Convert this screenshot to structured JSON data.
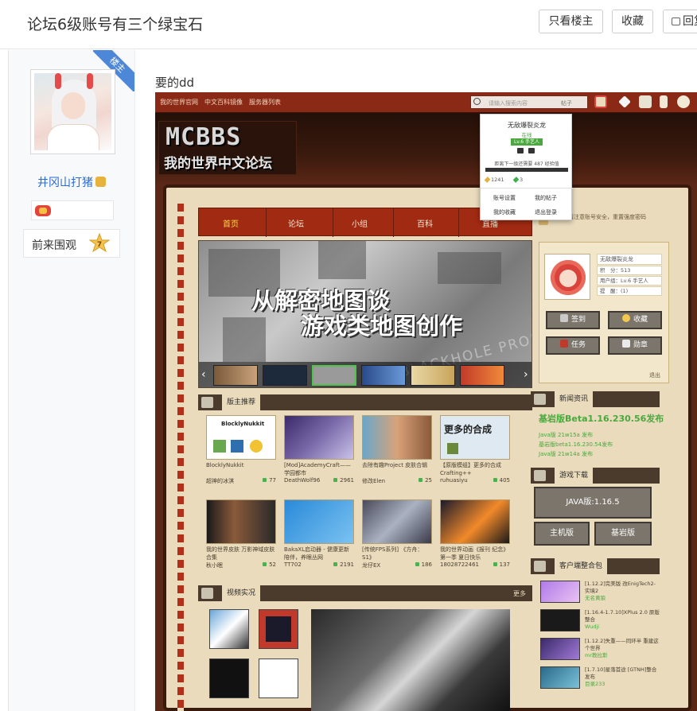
{
  "topbar": {
    "title": "论坛6级账号有三个绿宝石",
    "only_author_label": "只看楼主",
    "favorite_label": "收藏",
    "reply_label": "回复"
  },
  "author": {
    "ribbon": "楼主",
    "username": "井冈山打猪",
    "onlooker_label": "前来围观",
    "onlooker_count": "7"
  },
  "post": {
    "text": "要的dd"
  },
  "screenshot": {
    "top_nav": [
      "我的世界官网",
      "中文百科镜像",
      "服务器列表"
    ],
    "search_placeholder": "请输入搜索内容",
    "search_type": "帖子",
    "logo_en": "MCBBS",
    "logo_cn": "我的世界中文论坛",
    "main_nav": [
      "首页",
      "论坛",
      "小组",
      "百科",
      "直播"
    ],
    "notice": "用户：请注意账号安全，重置强度密码",
    "banner_line1": "从解密地图谈",
    "banner_line2": "游戏类地图创作",
    "banner_watermark": "BLACKHOLE PROJECT",
    "user_card": {
      "name": "无敌爆裂炎龙",
      "lines": [
        "积　分：513",
        "用户组：Lv.6 手艺人",
        "提　醒：(1)"
      ],
      "buttons": [
        "签到",
        "收藏",
        "任务",
        "勋章"
      ],
      "logout": "退出"
    },
    "dropdown": {
      "name": "无敌爆裂炎龙",
      "sub": "在线",
      "level": "Lv.6 手艺人",
      "exp": "距离下一级还需要 487 经验值",
      "gold": "1241",
      "emerald": "3",
      "links": [
        "账号设置",
        "我的帖子",
        "我的收藏",
        "退出登录"
      ]
    },
    "recommend": {
      "title": "版主推荐",
      "items": [
        {
          "title": "BlocklyNukkit",
          "author": "超神的冰淇",
          "count": "77"
        },
        {
          "title": "[Mod]AcademyCraft——学园都市",
          "author": "DeathWolf96",
          "count": "2961"
        },
        {
          "title": "去除有趣Project 皮肤合辑",
          "author": "修改Elen",
          "count": "25"
        },
        {
          "title": "【原版模组】更多的合成Crafting++",
          "author": "ruhuasiyu",
          "count": "405"
        },
        {
          "title": "我的世界皮肤 万影神域皮肤合集",
          "author": "秋小眠",
          "count": "52"
        },
        {
          "title": "BakaXL启动器 - 健康更新陪伴，养眼丛网",
          "author": "TT702",
          "count": "2191"
        },
        {
          "title": "[传统FPS系列] 《方舟：S1》",
          "author": "龙仔EX",
          "count": "186"
        },
        {
          "title": "我的世界动画《报刊 纪念》第一季 夏日快乐",
          "author": "18028722461",
          "count": "137"
        }
      ],
      "thumb_texts": [
        "BlocklyNukkit",
        "更多的合成"
      ]
    },
    "news": {
      "title": "新闻资讯",
      "headline": "基岩版Beta1.16.230.56发布",
      "lines": [
        "Java版 21w15a 发布",
        "基岩版beta1.16.230.54发布",
        "Java版 21w14a 发布"
      ]
    },
    "download": {
      "title": "游戏下载",
      "java": "JAVA版:1.16.5",
      "mobile": "主机版",
      "bedrock": "基岩版"
    },
    "packs": {
      "title": "客户端整合包",
      "items": [
        {
          "text": "[1.12.2]完美版 改EnigTech2-实境2",
          "author": "无名黄狼"
        },
        {
          "text": "[1.16.4-1.7.10]XPlus 2.0 原版整合",
          "author": "Wudji"
        },
        {
          "text": "[1.12.2]失重——同环半 重建这个世界",
          "author": "mr教拉斯"
        },
        {
          "text": "[1.7.10]星落首途 [GTNH]整合 发布",
          "author": "目录233"
        }
      ]
    },
    "video": {
      "title": "视频实况",
      "more": "更多"
    }
  },
  "colors": {
    "accent_blue": "#2b6bd6",
    "mc_red": "#a12a12",
    "mc_green": "#4ba83e"
  }
}
